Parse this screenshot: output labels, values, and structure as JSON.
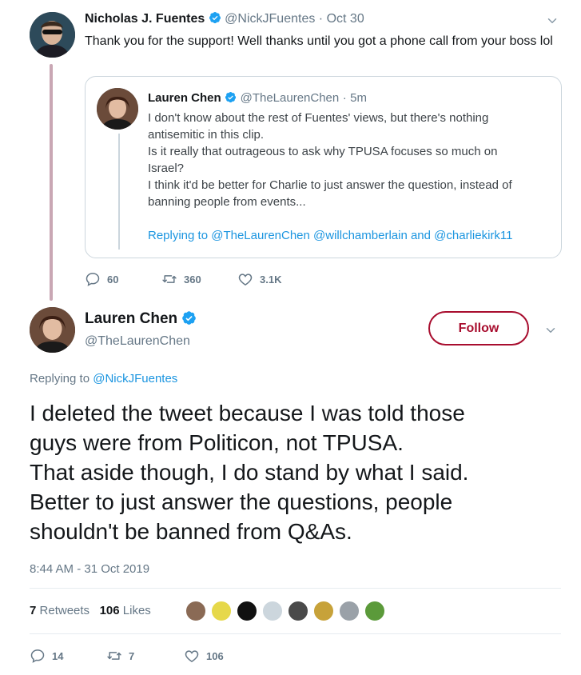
{
  "parent_tweet": {
    "name": "Nicholas J. Fuentes",
    "handle": "@NickJFuentes",
    "sep": "·",
    "date": "Oct 30",
    "text": "Thank you for the support! Well thanks until you got a phone call from your boss lol",
    "quoted": {
      "name": "Lauren Chen",
      "handle": "@TheLaurenChen",
      "sep": "·",
      "time": "5m",
      "lines": [
        "I don't know about the rest of Fuentes' views, but there's nothing",
        "antisemitic in this clip.",
        "Is it really that outrageous to ask why TPUSA focuses so much on",
        "Israel?",
        "I think it'd be better for Charlie to just answer the question, instead of",
        "banning people from events..."
      ],
      "replying_prefix": "Replying to",
      "replying_to": "@TheLaurenChen @willchamberlain and @charliekirk11"
    },
    "actions": {
      "replies": "60",
      "retweets": "360",
      "likes": "3.1K"
    }
  },
  "main_tweet": {
    "name": "Lauren Chen",
    "handle": "@TheLaurenChen",
    "follow_label": "Follow",
    "replying_prefix": "Replying to",
    "replying_to": "@NickJFuentes",
    "lines": [
      "I deleted the tweet because I was told those",
      "guys were from Politicon, not TPUSA.",
      "That aside though, I do stand by what I said.",
      "Better to just answer the questions, people",
      "shouldn't be banned from Q&As."
    ],
    "timestamp": "8:44 AM - 31 Oct 2019",
    "retweets_count": "7",
    "retweets_label": "Retweets",
    "likes_count": "106",
    "likes_label": "Likes",
    "actions": {
      "replies": "14",
      "retweets": "7",
      "likes": "106"
    }
  },
  "colors": {
    "verified": "#1da1f2",
    "follow": "#a80d2e",
    "thread_line": "#c9a7b4",
    "link": "#1b95e0"
  }
}
